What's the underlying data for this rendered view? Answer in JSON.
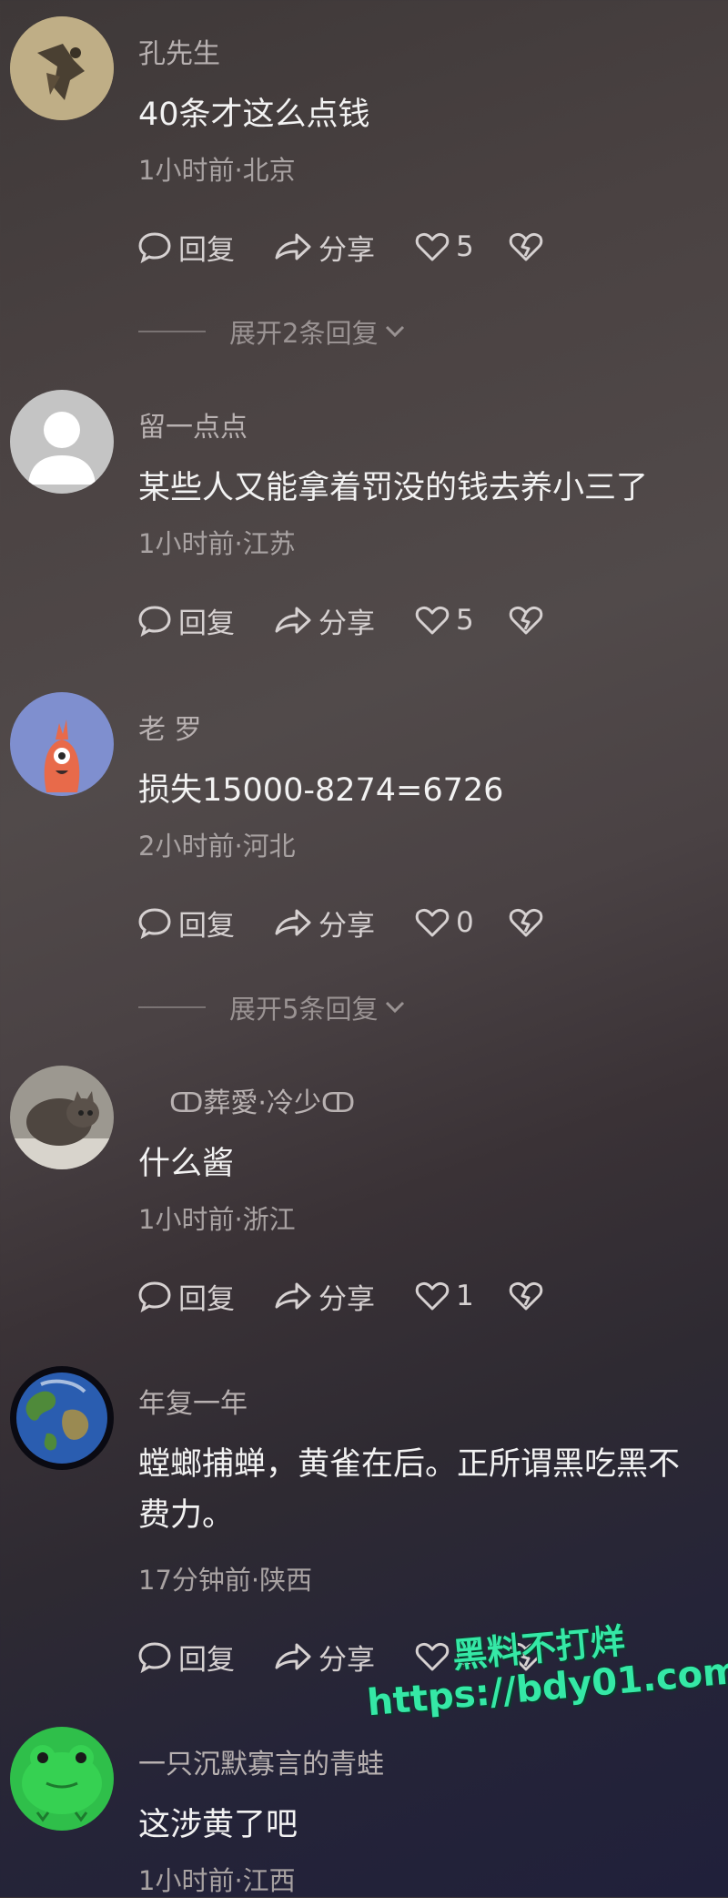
{
  "comments": [
    {
      "username": "孔先生",
      "content": "40条才这么点钱",
      "meta": "1小时前·北京",
      "reply_label": "回复",
      "share_label": "分享",
      "likes": "5",
      "expand_label": "展开2条回复"
    },
    {
      "username": "留一点点",
      "content": "某些人又能拿着罚没的钱去养小三了",
      "meta": "1小时前·江苏",
      "reply_label": "回复",
      "share_label": "分享",
      "likes": "5"
    },
    {
      "username": "老 罗",
      "content": "损失15000-8274=6726",
      "meta": "2小时前·河北",
      "reply_label": "回复",
      "share_label": "分享",
      "likes": "0",
      "expand_label": "展开5条回复"
    },
    {
      "username": "ↀ葬愛·冷少ↀ",
      "content": "什么酱",
      "meta": "1小时前·浙江",
      "reply_label": "回复",
      "share_label": "分享",
      "likes": "1"
    },
    {
      "username": "年复一年",
      "content": "螳螂捕蝉，黄雀在后。正所谓黑吃黑不费力。",
      "meta": "17分钟前·陕西",
      "reply_label": "回复",
      "share_label": "分享",
      "likes": "0"
    },
    {
      "username": "一只沉默寡言的青蛙",
      "content": "这涉黄了吧",
      "meta": "1小时前·江西"
    }
  ],
  "watermark": {
    "line1": "黑料不打烊",
    "line2": "https://bdy01.com"
  },
  "icons": {
    "reply": "comment-bubble-icon",
    "share": "share-arrow-icon",
    "like": "heart-icon",
    "dislike": "broken-heart-icon"
  },
  "colors": {
    "watermark": "#35e8a6",
    "text_primary": "#f2f2f2",
    "text_secondary": "#a8a2a2"
  }
}
